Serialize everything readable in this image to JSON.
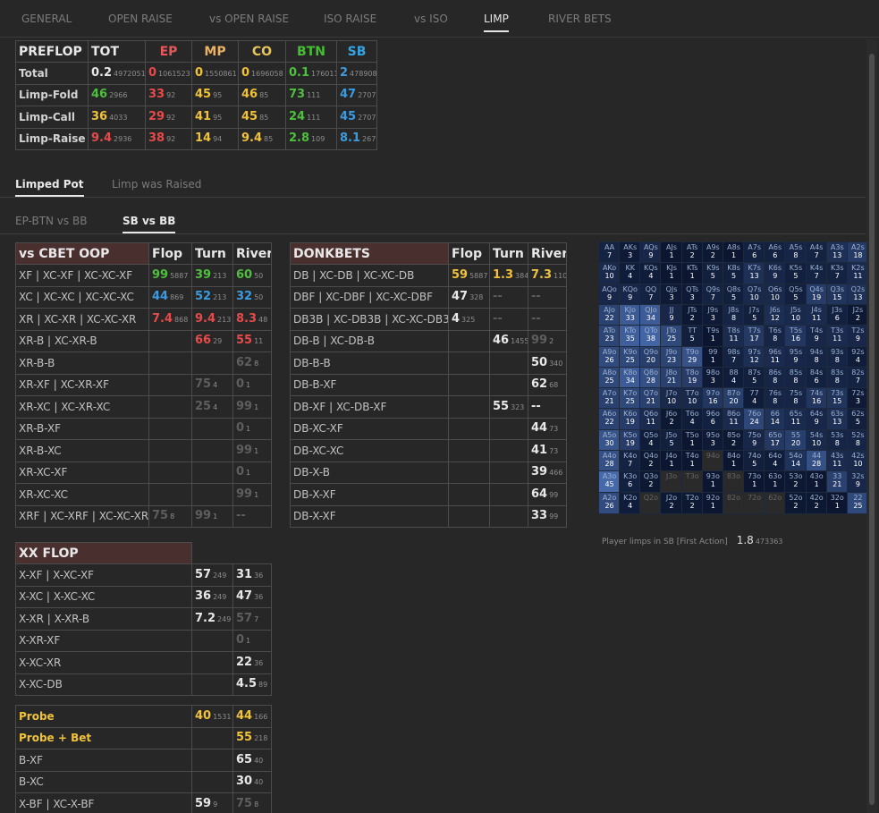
{
  "nav": {
    "tabs": [
      "GENERAL",
      "OPEN RAISE",
      "vs OPEN RAISE",
      "ISO RAISE",
      "vs ISO",
      "LIMP",
      "RIVER BETS"
    ],
    "active": "LIMP"
  },
  "preflop": {
    "headers": [
      "PREFLOP",
      "TOT",
      "EP",
      "MP",
      "CO",
      "BTN",
      "SB"
    ],
    "rows": [
      {
        "label": "Total",
        "cells": [
          [
            "0.2",
            "4972051"
          ],
          [
            "0",
            "1061523"
          ],
          [
            "0",
            "1550861"
          ],
          [
            "0",
            "1696058"
          ],
          [
            "0.1",
            "1760111"
          ],
          [
            "2",
            "478908"
          ]
        ]
      },
      {
        "label": "Limp-Fold",
        "cells": [
          [
            "46",
            "2966"
          ],
          [
            "33",
            "92"
          ],
          [
            "45",
            "95"
          ],
          [
            "46",
            "85"
          ],
          [
            "73",
            "111"
          ],
          [
            "47",
            "2707"
          ]
        ]
      },
      {
        "label": "Limp-Call",
        "cells": [
          [
            "36",
            "4033"
          ],
          [
            "29",
            "92"
          ],
          [
            "41",
            "95"
          ],
          [
            "45",
            "85"
          ],
          [
            "24",
            "111"
          ],
          [
            "45",
            "2707"
          ]
        ]
      },
      {
        "label": "Limp-Raise",
        "cells": [
          [
            "9.4",
            "2936"
          ],
          [
            "38",
            "92"
          ],
          [
            "14",
            "94"
          ],
          [
            "9.4",
            "85"
          ],
          [
            "2.8",
            "109"
          ],
          [
            "8.1",
            "2679"
          ]
        ]
      }
    ]
  },
  "section_tabs": {
    "items": [
      "Limped Pot",
      "Limp was Raised"
    ],
    "active": "Limped Pot"
  },
  "matchup_tabs": {
    "items": [
      "EP-BTN vs BB",
      "SB vs BB"
    ],
    "active": "SB vs BB"
  },
  "cbet": {
    "headers": [
      "vs CBET OOP",
      "Flop",
      "Turn",
      "River"
    ],
    "rows": [
      {
        "label": "XF | XC-XF | XC-XC-XF",
        "flop": [
          "99",
          "5887"
        ],
        "turn": [
          "39",
          "213"
        ],
        "river": [
          "60",
          "50"
        ]
      },
      {
        "label": "XC | XC-XC | XC-XC-XC",
        "flop": [
          "44",
          "869"
        ],
        "turn": [
          "52",
          "213"
        ],
        "river": [
          "32",
          "50"
        ]
      },
      {
        "label": "XR | XC-XR | XC-XC-XR",
        "flop": [
          "7.4",
          "868"
        ],
        "turn": [
          "9.4",
          "213"
        ],
        "river": [
          "8.3",
          "48"
        ]
      },
      {
        "label": "XR-B | XC-XR-B",
        "flop": null,
        "turn": [
          "66",
          "29"
        ],
        "river": [
          "55",
          "11"
        ]
      },
      {
        "label": "XR-B-B",
        "flop": null,
        "turn": null,
        "river": [
          "62",
          "8"
        ]
      },
      {
        "label": "XR-XF | XC-XR-XF",
        "flop": null,
        "turn": [
          "75",
          "4"
        ],
        "river": [
          "0",
          "1"
        ]
      },
      {
        "label": "XR-XC | XC-XR-XC",
        "flop": null,
        "turn": [
          "25",
          "4"
        ],
        "river": [
          "99",
          "1"
        ]
      },
      {
        "label": "XR-B-XF",
        "flop": null,
        "turn": null,
        "river": [
          "0",
          "1"
        ]
      },
      {
        "label": "XR-B-XC",
        "flop": null,
        "turn": null,
        "river": [
          "99",
          "1"
        ]
      },
      {
        "label": "XR-XC-XF",
        "flop": null,
        "turn": null,
        "river": [
          "0",
          "1"
        ]
      },
      {
        "label": "XR-XC-XC",
        "flop": null,
        "turn": null,
        "river": [
          "99",
          "1"
        ]
      },
      {
        "label": "XRF | XC-XRF | XC-XC-XRF",
        "flop": [
          "75",
          "8"
        ],
        "turn": [
          "99",
          "1"
        ],
        "river": [
          "--",
          ""
        ]
      }
    ]
  },
  "donk": {
    "headers": [
      "DONKBETS",
      "Flop",
      "Turn",
      "River"
    ],
    "rows": [
      {
        "label": "DB | XC-DB | XC-XC-DB",
        "flop": [
          "59",
          "5887"
        ],
        "turn": [
          "1.3",
          "384"
        ],
        "river": [
          "7.3",
          "110"
        ]
      },
      {
        "label": "DBF | XC-DBF | XC-XC-DBF",
        "flop": [
          "47",
          "328"
        ],
        "turn": [
          "--",
          ""
        ],
        "river": [
          "--",
          ""
        ]
      },
      {
        "label": "DB3B | XC-DB3B | XC-XC-DB3B",
        "flop": [
          "4",
          "325"
        ],
        "turn": [
          "--",
          ""
        ],
        "river": [
          "--",
          ""
        ]
      },
      {
        "label": "DB-B | XC-DB-B",
        "flop": null,
        "turn": [
          "46",
          "1455"
        ],
        "river": [
          "99",
          "2"
        ]
      },
      {
        "label": "DB-B-B",
        "flop": null,
        "turn": null,
        "river": [
          "50",
          "340"
        ]
      },
      {
        "label": "DB-B-XF",
        "flop": null,
        "turn": null,
        "river": [
          "62",
          "68"
        ]
      },
      {
        "label": "DB-XF | XC-DB-XF",
        "flop": null,
        "turn": [
          "55",
          "323"
        ],
        "river": [
          "--",
          ""
        ]
      },
      {
        "label": "DB-XC-XF",
        "flop": null,
        "turn": null,
        "river": [
          "44",
          "73"
        ]
      },
      {
        "label": "DB-XC-XC",
        "flop": null,
        "turn": null,
        "river": [
          "41",
          "73"
        ]
      },
      {
        "label": "DB-X-B",
        "flop": null,
        "turn": null,
        "river": [
          "39",
          "466"
        ]
      },
      {
        "label": "DB-X-XF",
        "flop": null,
        "turn": null,
        "river": [
          "64",
          "99"
        ]
      },
      {
        "label": "DB-X-XF",
        "flop": null,
        "turn": null,
        "river": [
          "33",
          "99"
        ]
      }
    ]
  },
  "xx": {
    "header": "XX FLOP",
    "rows": [
      {
        "label": "X-XF | X-XC-XF",
        "a": [
          "57",
          "249"
        ],
        "b": [
          "31",
          "36"
        ]
      },
      {
        "label": "X-XC | X-XC-XC",
        "a": [
          "36",
          "249"
        ],
        "b": [
          "47",
          "36"
        ]
      },
      {
        "label": "X-XR | X-XR-B",
        "a": [
          "7.2",
          "249"
        ],
        "b": [
          "57",
          "7"
        ]
      },
      {
        "label": "X-XR-XF",
        "a": null,
        "b": [
          "0",
          "1"
        ]
      },
      {
        "label": "X-XC-XR",
        "a": null,
        "b": [
          "22",
          "36"
        ]
      },
      {
        "label": "X-XC-DB",
        "a": null,
        "b": [
          "4.5",
          "89"
        ]
      }
    ]
  },
  "probe": {
    "rows": [
      {
        "label": "Probe",
        "gold": true,
        "a": [
          "40",
          "1531"
        ],
        "b": [
          "44",
          "166"
        ]
      },
      {
        "label": "Probe + Bet",
        "gold": true,
        "a": null,
        "b": [
          "55",
          "218"
        ]
      },
      {
        "label": "B-XF",
        "gold": false,
        "a": null,
        "b": [
          "65",
          "40"
        ]
      },
      {
        "label": "B-XC",
        "gold": false,
        "a": null,
        "b": [
          "30",
          "40"
        ]
      },
      {
        "label": "X-BF | XC-X-BF",
        "gold": false,
        "a": [
          "59",
          "9"
        ],
        "b": [
          "75",
          "8"
        ]
      }
    ]
  },
  "hand_grid": {
    "cells": [
      [
        "AA",
        "7"
      ],
      [
        "AKs",
        "3"
      ],
      [
        "AQs",
        "9"
      ],
      [
        "AJs",
        "1"
      ],
      [
        "ATs",
        "2"
      ],
      [
        "A9s",
        "2"
      ],
      [
        "A8s",
        "1"
      ],
      [
        "A7s",
        "6"
      ],
      [
        "A6s",
        "6"
      ],
      [
        "A5s",
        "8"
      ],
      [
        "A4s",
        "7"
      ],
      [
        "A3s",
        "13"
      ],
      [
        "A2s",
        "18"
      ],
      [
        "AKo",
        "10"
      ],
      [
        "KK",
        "4"
      ],
      [
        "KQs",
        "4"
      ],
      [
        "KJs",
        "1"
      ],
      [
        "KTs",
        "1"
      ],
      [
        "K9s",
        "5"
      ],
      [
        "K8s",
        "5"
      ],
      [
        "K7s",
        "13"
      ],
      [
        "K6s",
        "9"
      ],
      [
        "K5s",
        "5"
      ],
      [
        "K4s",
        "7"
      ],
      [
        "K3s",
        "7"
      ],
      [
        "K2s",
        "11"
      ],
      [
        "AQo",
        "9"
      ],
      [
        "KQo",
        "9"
      ],
      [
        "QQ",
        "7"
      ],
      [
        "QJs",
        "3"
      ],
      [
        "QTs",
        "3"
      ],
      [
        "Q9s",
        "7"
      ],
      [
        "Q8s",
        "5"
      ],
      [
        "Q7s",
        "10"
      ],
      [
        "Q6s",
        "10"
      ],
      [
        "Q5s",
        "5"
      ],
      [
        "Q4s",
        "19"
      ],
      [
        "Q3s",
        "15"
      ],
      [
        "Q2s",
        "13"
      ],
      [
        "AJo",
        "22"
      ],
      [
        "KJo",
        "33"
      ],
      [
        "QJo",
        "34"
      ],
      [
        "JJ",
        "9"
      ],
      [
        "JTs",
        "2"
      ],
      [
        "J9s",
        "3"
      ],
      [
        "J8s",
        "8"
      ],
      [
        "J7s",
        "5"
      ],
      [
        "J6s",
        "12"
      ],
      [
        "J5s",
        "10"
      ],
      [
        "J4s",
        "11"
      ],
      [
        "J3s",
        "6"
      ],
      [
        "J2s",
        "2"
      ],
      [
        "ATo",
        "23"
      ],
      [
        "KTo",
        "35"
      ],
      [
        "QTo",
        "38"
      ],
      [
        "JTo",
        "25"
      ],
      [
        "TT",
        "5"
      ],
      [
        "T9s",
        "1"
      ],
      [
        "T8s",
        "11"
      ],
      [
        "T7s",
        "17"
      ],
      [
        "T6s",
        "8"
      ],
      [
        "T5s",
        "16"
      ],
      [
        "T4s",
        "9"
      ],
      [
        "T3s",
        "11"
      ],
      [
        "T2s",
        "9"
      ],
      [
        "A9o",
        "26"
      ],
      [
        "K9o",
        "25"
      ],
      [
        "Q9o",
        "20"
      ],
      [
        "J9o",
        "23"
      ],
      [
        "T9o",
        "29"
      ],
      [
        "99",
        "1"
      ],
      [
        "98s",
        "7"
      ],
      [
        "97s",
        "12"
      ],
      [
        "96s",
        "11"
      ],
      [
        "95s",
        "9"
      ],
      [
        "94s",
        "8"
      ],
      [
        "93s",
        "8"
      ],
      [
        "92s",
        "4"
      ],
      [
        "A8o",
        "25"
      ],
      [
        "K8o",
        "34"
      ],
      [
        "Q8o",
        "28"
      ],
      [
        "J8o",
        "21"
      ],
      [
        "T8o",
        "19"
      ],
      [
        "98o",
        "3"
      ],
      [
        "88",
        "4"
      ],
      [
        "87s",
        "5"
      ],
      [
        "86s",
        "8"
      ],
      [
        "85s",
        "8"
      ],
      [
        "84s",
        "6"
      ],
      [
        "83s",
        "8"
      ],
      [
        "82s",
        "7"
      ],
      [
        "A7o",
        "21"
      ],
      [
        "K7o",
        "25"
      ],
      [
        "Q7o",
        "21"
      ],
      [
        "J7o",
        "10"
      ],
      [
        "T7o",
        "10"
      ],
      [
        "97o",
        "16"
      ],
      [
        "87o",
        "20"
      ],
      [
        "77",
        "4"
      ],
      [
        "76s",
        "8"
      ],
      [
        "75s",
        "8"
      ],
      [
        "74s",
        "16"
      ],
      [
        "73s",
        "15"
      ],
      [
        "72s",
        "3"
      ],
      [
        "A6o",
        "22"
      ],
      [
        "K6o",
        "19"
      ],
      [
        "Q6o",
        "11"
      ],
      [
        "J6o",
        "2"
      ],
      [
        "T6o",
        "4"
      ],
      [
        "96o",
        "6"
      ],
      [
        "86o",
        "11"
      ],
      [
        "76o",
        "24"
      ],
      [
        "66",
        "14"
      ],
      [
        "65s",
        "11"
      ],
      [
        "64s",
        "9"
      ],
      [
        "63s",
        "13"
      ],
      [
        "62s",
        "5"
      ],
      [
        "A5o",
        "30"
      ],
      [
        "K5o",
        "19"
      ],
      [
        "Q5o",
        "4"
      ],
      [
        "J5o",
        "5"
      ],
      [
        "T5o",
        "1"
      ],
      [
        "95o",
        "3"
      ],
      [
        "85o",
        "2"
      ],
      [
        "75o",
        "9"
      ],
      [
        "65o",
        "17"
      ],
      [
        "55",
        "20"
      ],
      [
        "54s",
        "10"
      ],
      [
        "53s",
        "8"
      ],
      [
        "52s",
        "8"
      ],
      [
        "A4o",
        "28"
      ],
      [
        "K4o",
        "7"
      ],
      [
        "Q4o",
        "2"
      ],
      [
        "J4o",
        "1"
      ],
      [
        "T4o",
        "1"
      ],
      [
        "94o",
        ""
      ],
      [
        "84o",
        "1"
      ],
      [
        "74o",
        "5"
      ],
      [
        "64o",
        "4"
      ],
      [
        "54o",
        "14"
      ],
      [
        "44",
        "28"
      ],
      [
        "43s",
        "11"
      ],
      [
        "42s",
        "10"
      ],
      [
        "A3o",
        "45"
      ],
      [
        "K3o",
        "6"
      ],
      [
        "Q3o",
        "2"
      ],
      [
        "J3o",
        ""
      ],
      [
        "T3o",
        ""
      ],
      [
        "93o",
        "1"
      ],
      [
        "83o",
        ""
      ],
      [
        "73o",
        "1"
      ],
      [
        "63o",
        "1"
      ],
      [
        "53o",
        "2"
      ],
      [
        "43o",
        "1"
      ],
      [
        "33",
        "21"
      ],
      [
        "32s",
        "9"
      ],
      [
        "A2o",
        "26"
      ],
      [
        "K2o",
        "4"
      ],
      [
        "Q2o",
        ""
      ],
      [
        "J2o",
        "2"
      ],
      [
        "T2o",
        "2"
      ],
      [
        "92o",
        "1"
      ],
      [
        "82o",
        ""
      ],
      [
        "72o",
        ""
      ],
      [
        "62o",
        ""
      ],
      [
        "52o",
        "2"
      ],
      [
        "42o",
        "2"
      ],
      [
        "32o",
        "1"
      ],
      [
        "22",
        "25"
      ]
    ]
  },
  "footer": {
    "label": "Player limps in SB [First Action]",
    "value": "1.8",
    "sample": "473363"
  }
}
